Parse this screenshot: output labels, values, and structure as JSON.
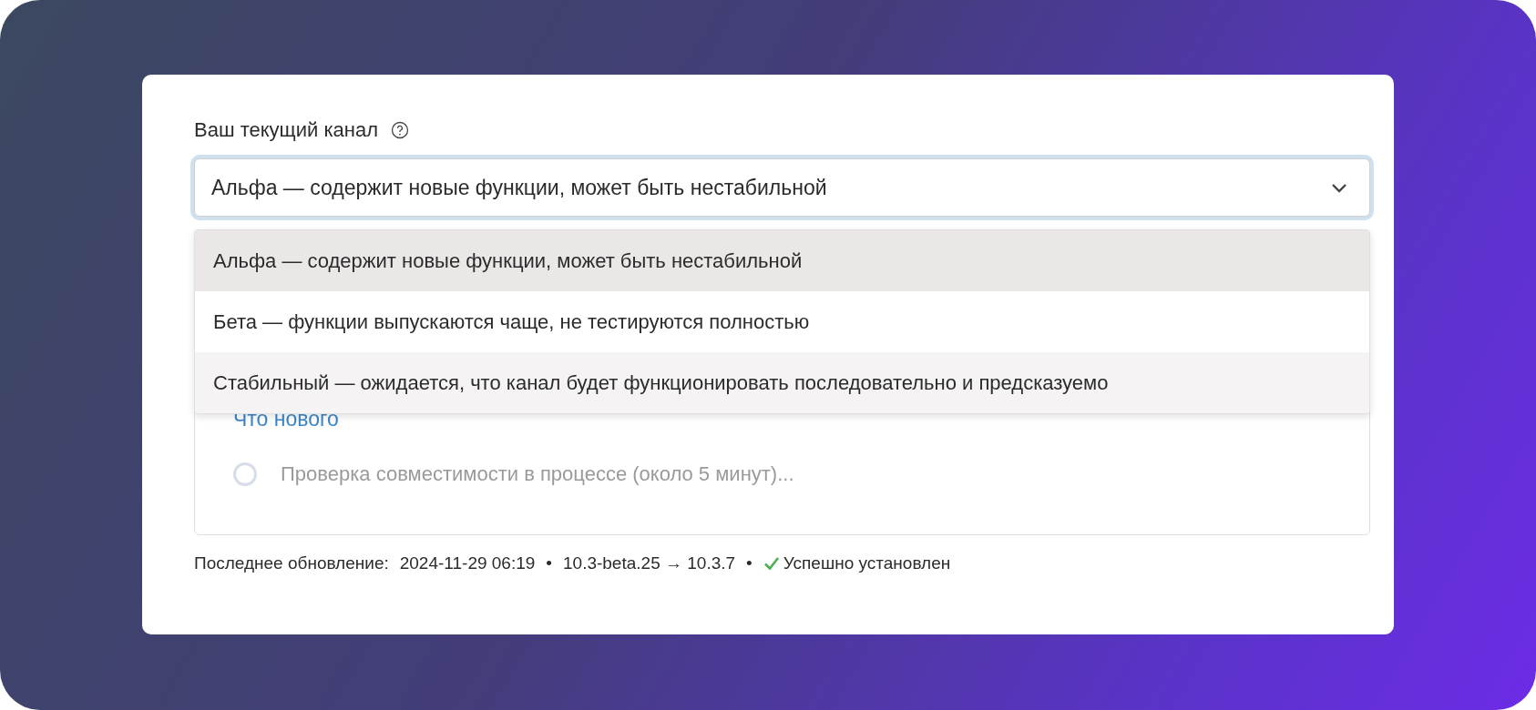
{
  "field": {
    "label": "Ваш текущий канал",
    "value": "Альфа — содержит новые функции, может быть нестабильной",
    "expanded": true
  },
  "options": [
    {
      "label": "Альфа — содержит новые функции, может быть нестабильной",
      "selected": true,
      "hovered": false
    },
    {
      "label": "Бета — функции выпускаются чаще, не тестируются полностью",
      "selected": false,
      "hovered": false
    },
    {
      "label": "Стабильный — ожидается, что канал будет функционировать последовательно и предсказуемо",
      "selected": false,
      "hovered": true
    }
  ],
  "panel": {
    "link": "Что нового",
    "status": "Проверка совместимости в процессе (около 5 минут)..."
  },
  "footer": {
    "label": "Последнее обновление:",
    "date": "2024-11-29 06:19",
    "separator_1": "•",
    "versions": "10.3-beta.25 → 10.3.7",
    "separator_2": "•",
    "result": "Успешно установлен",
    "success": true
  }
}
